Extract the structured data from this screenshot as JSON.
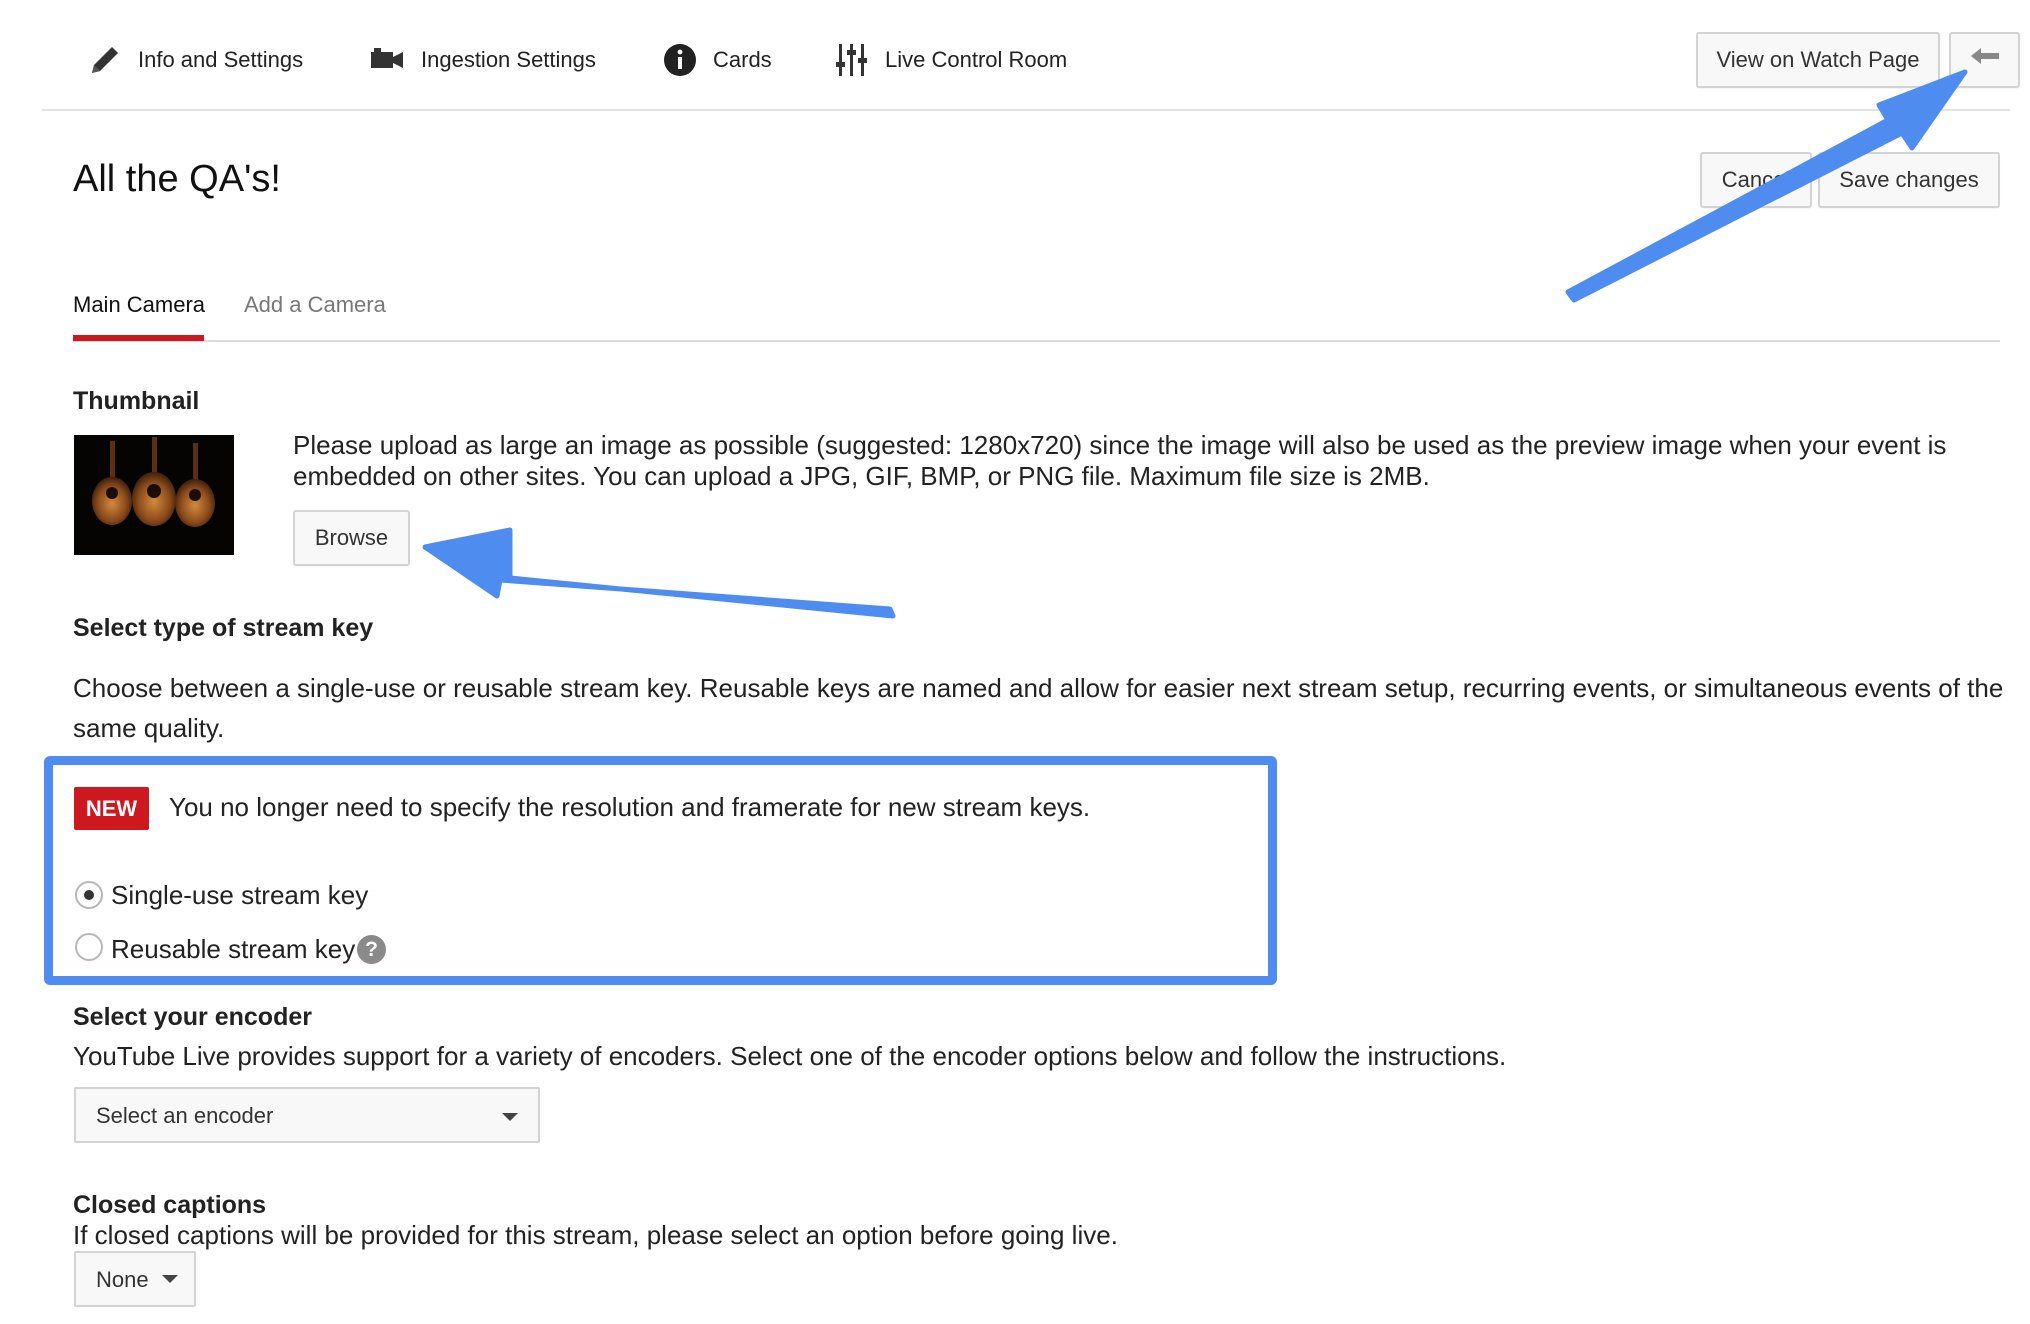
{
  "nav": {
    "items": [
      {
        "label": "Info and Settings",
        "icon": "pencil-icon"
      },
      {
        "label": "Ingestion Settings",
        "icon": "video-camera-icon"
      },
      {
        "label": "Cards",
        "icon": "info-icon"
      },
      {
        "label": "Live Control Room",
        "icon": "sliders-icon"
      }
    ],
    "view_on_watch_page": "View on Watch Page",
    "back_icon": "back-arrow-icon"
  },
  "header": {
    "title": "All the QA's!",
    "cancel_label": "Cancel",
    "save_label": "Save changes"
  },
  "tabs": [
    {
      "label": "Main Camera",
      "active": true
    },
    {
      "label": "Add a Camera",
      "active": false
    }
  ],
  "thumbnail": {
    "title": "Thumbnail",
    "description": "Please upload as large an image as possible (suggested: 1280x720) since the image will also be used as the preview image when your event is embedded on other sites. You can upload a JPG, GIF, BMP, or PNG file. Maximum file size is 2MB.",
    "browse_label": "Browse"
  },
  "stream_key": {
    "title": "Select type of stream key",
    "description": "Choose between a single-use or reusable stream key. Reusable keys are named and allow for easier next stream setup, recurring events, or simultaneous events of the same quality.",
    "badge": "NEW",
    "notice": "You no longer need to specify the resolution and framerate for new stream keys.",
    "options": [
      {
        "label": "Single-use stream key",
        "selected": true
      },
      {
        "label": "Reusable stream key",
        "selected": false,
        "help": "?"
      }
    ]
  },
  "encoder": {
    "title": "Select your encoder",
    "description": "YouTube Live provides support for a variety of encoders. Select one of the encoder options below and follow the instructions.",
    "select_value": "Select an encoder"
  },
  "captions": {
    "title": "Closed captions",
    "description": "If closed captions will be provided for this stream, please select an option before going live.",
    "select_value": "None"
  },
  "colors": {
    "accent_red": "#cc181e",
    "annotation_blue": "#4f8cf0"
  }
}
